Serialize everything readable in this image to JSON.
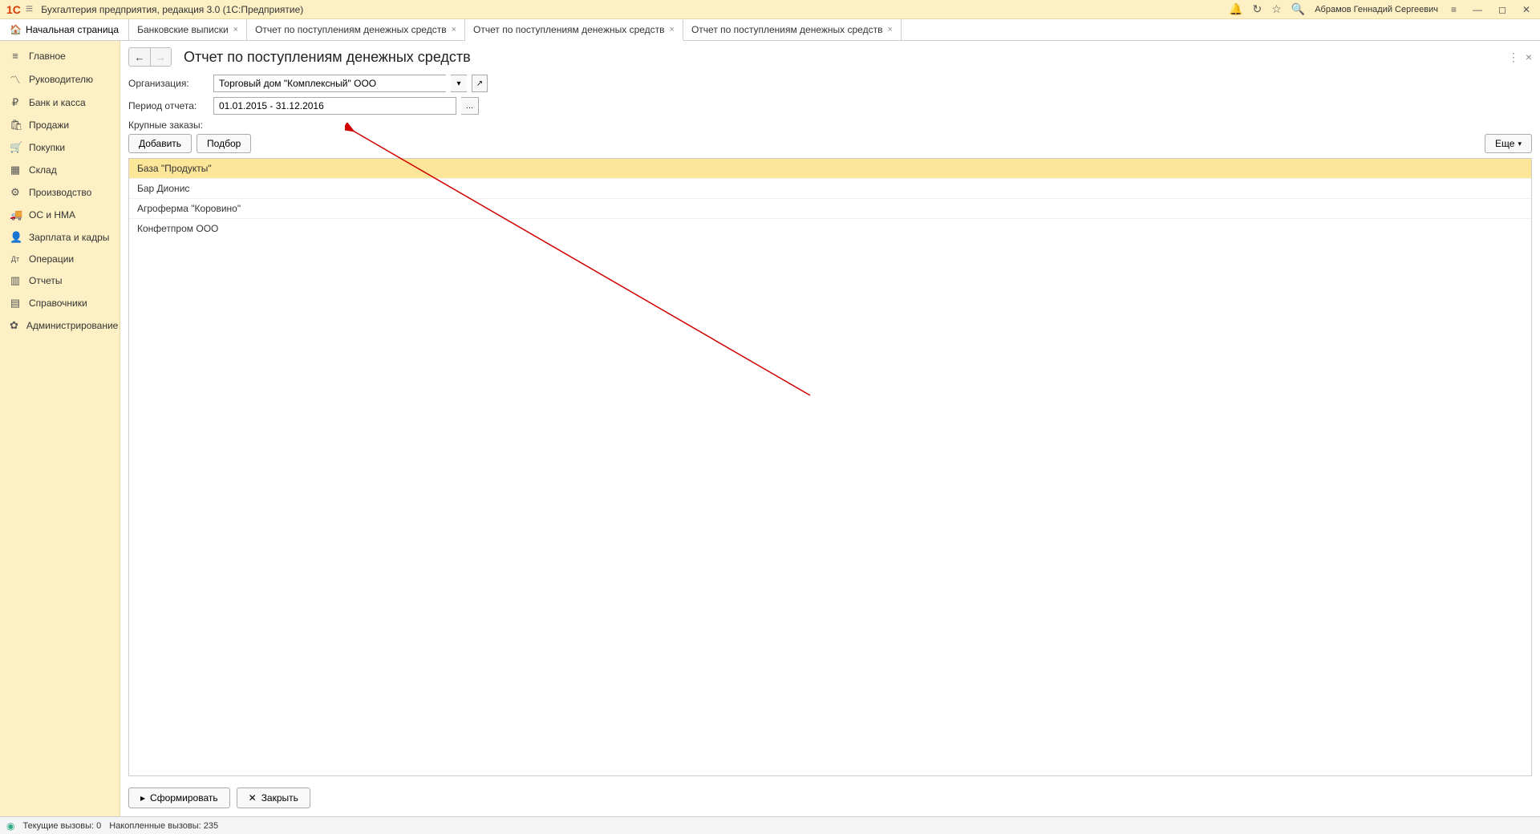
{
  "titlebar": {
    "app_title": "Бухгалтерия предприятия, редакция 3.0  (1С:Предприятие)",
    "username": "Абрамов Геннадий Сергеевич"
  },
  "tabs": {
    "home": "Начальная страница",
    "items": [
      {
        "label": "Банковские выписки",
        "active": false
      },
      {
        "label": "Отчет по поступлениям денежных средств",
        "active": false
      },
      {
        "label": "Отчет по поступлениям денежных средств",
        "active": true
      },
      {
        "label": "Отчет по поступлениям денежных средств",
        "active": false
      }
    ]
  },
  "sidebar": {
    "items": [
      {
        "icon": "≡",
        "label": "Главное"
      },
      {
        "icon": "📈",
        "label": "Руководителю"
      },
      {
        "icon": "₽",
        "label": "Банк и касса"
      },
      {
        "icon": "🛍",
        "label": "Продажи"
      },
      {
        "icon": "🛒",
        "label": "Покупки"
      },
      {
        "icon": "📦",
        "label": "Склад"
      },
      {
        "icon": "🏭",
        "label": "Производство"
      },
      {
        "icon": "🚚",
        "label": "ОС и НМА"
      },
      {
        "icon": "👤",
        "label": "Зарплата и кадры"
      },
      {
        "icon": "Дт",
        "label": "Операции"
      },
      {
        "icon": "📊",
        "label": "Отчеты"
      },
      {
        "icon": "📘",
        "label": "Справочники"
      },
      {
        "icon": "⚙",
        "label": "Администрирование"
      }
    ]
  },
  "page": {
    "title": "Отчет по поступлениям денежных средств",
    "org_label": "Организация:",
    "org_value": "Торговый дом \"Комплексный\" ООО",
    "period_label": "Период отчета:",
    "period_value": "01.01.2015 - 31.12.2016",
    "section_label": "Крупные заказы:",
    "add_btn": "Добавить",
    "select_btn": "Подбор",
    "more_btn": "Еще",
    "list": [
      {
        "label": "База \"Продукты\"",
        "selected": true
      },
      {
        "label": "Бар Дионис",
        "selected": false
      },
      {
        "label": "Агроферма \"Коровино\"",
        "selected": false
      },
      {
        "label": "Конфетпром ООО",
        "selected": false
      }
    ],
    "generate_btn": "Сформировать",
    "close_btn": "Закрыть"
  },
  "statusbar": {
    "current_calls": "Текущие вызовы: 0",
    "accumulated_calls": "Накопленные вызовы: 235"
  }
}
